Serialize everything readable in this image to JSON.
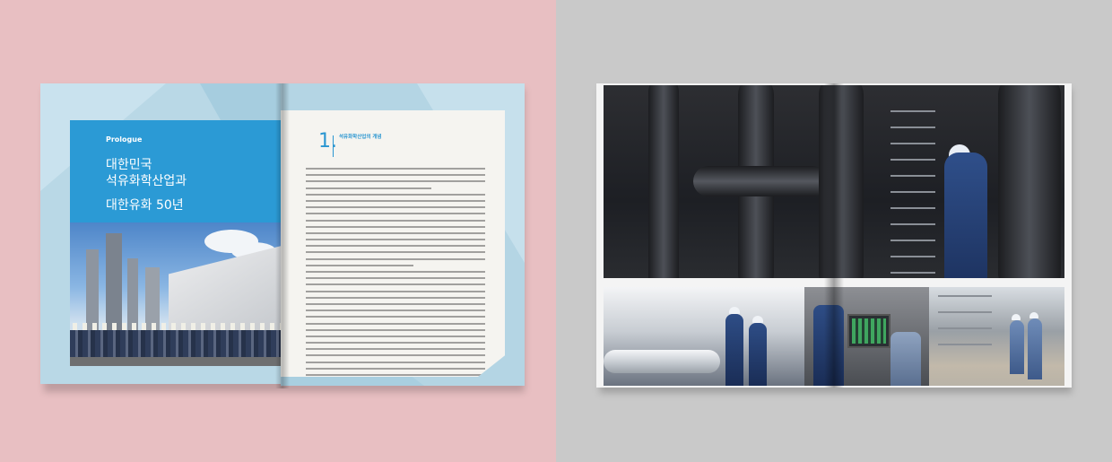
{
  "left_spread": {
    "prologue_label": "Prologue",
    "title_line1": "대한민국",
    "title_line2": "석유화학산업과",
    "title_line3": "대한유화 50년",
    "section_number": "1.",
    "section_title": "석유화학산업의 개념"
  },
  "colors": {
    "left_background": "#e8bfc2",
    "right_background": "#c9c9c9",
    "accent_blue": "#2b9ad5",
    "page_bg": "#b9d8e6"
  }
}
